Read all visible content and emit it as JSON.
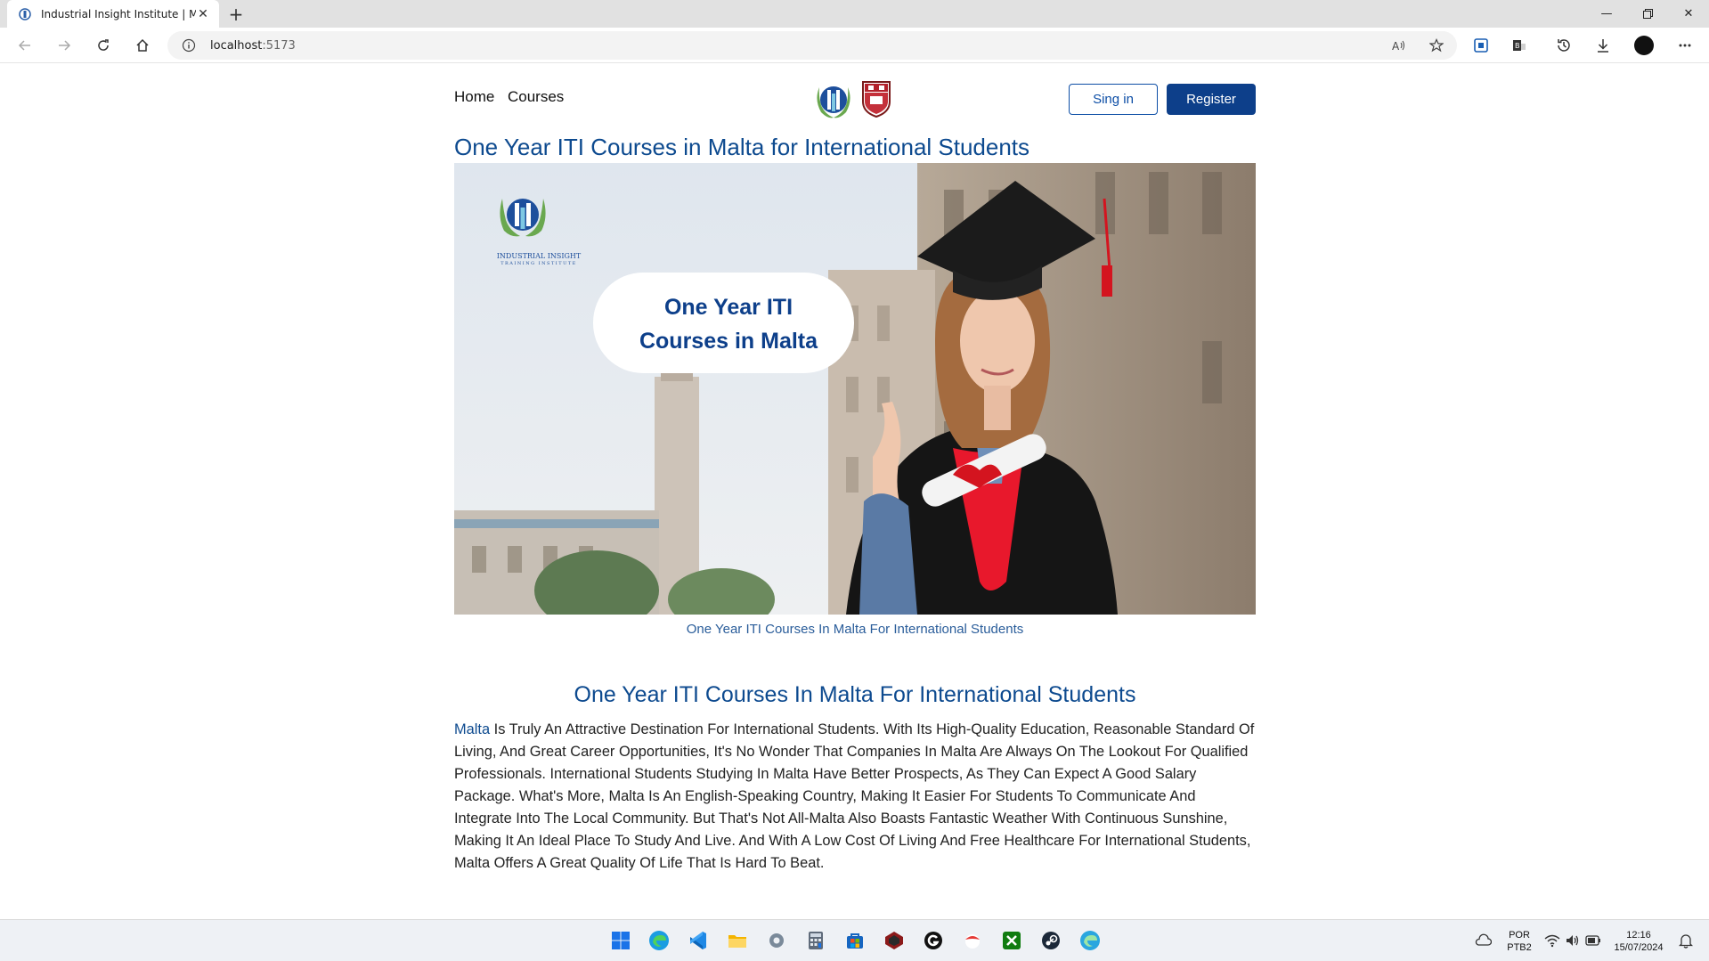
{
  "browser": {
    "tab_title": "Industrial Insight Institute | Malta",
    "url_host": "localhost",
    "url_port": ":5173"
  },
  "nav": {
    "links": [
      "Home",
      "Courses"
    ],
    "signin_label": "Sing in",
    "register_label": "Register"
  },
  "main": {
    "title": "One Year ITI Courses in Malta for International Students",
    "hero": {
      "logo_line1": "INDUSTRIAL INSIGHT",
      "logo_line2": "TRAINING INSTITUTE",
      "bubble_line1": "One Year ITI",
      "bubble_line2": "Courses in Malta"
    },
    "caption": "One Year ITI Courses In Malta For International Students",
    "section_title": "One Year ITI Courses In Malta For International Students",
    "paragraph_link": "Malta",
    "paragraph_text": " Is Truly An Attractive Destination For International Students. With Its High-Quality Education, Reasonable Standard Of Living, And Great Career Opportunities, It's No Wonder That Companies In Malta Are Always On The Lookout For Qualified Professionals. International Students Studying In Malta Have Better Prospects, As They Can Expect A Good Salary Package. What's More, Malta Is An English-Speaking Country, Making It Easier For Students To Communicate And Integrate Into The Local Community. But That's Not All-Malta Also Boasts Fantastic Weather With Continuous Sunshine, Making It An Ideal Place To Study And Live. And With A Low Cost Of Living And Free Healthcare For International Students, Malta Offers A Great Quality Of Life That Is Hard To Beat."
  },
  "taskbar": {
    "lang_line1": "POR",
    "lang_line2": "PTB2",
    "time": "12:16",
    "date": "15/07/2024"
  },
  "colors": {
    "brand_blue": "#0d4a8f",
    "button_blue": "#0d3f8a",
    "gown_red": "#e8182c"
  }
}
